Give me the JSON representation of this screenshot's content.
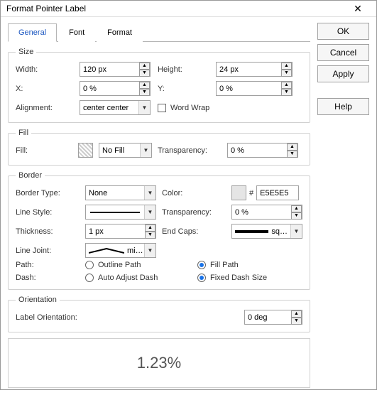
{
  "window": {
    "title": "Format Pointer Label"
  },
  "tabs": [
    "General",
    "Font",
    "Format"
  ],
  "buttons": {
    "ok": "OK",
    "cancel": "Cancel",
    "apply": "Apply",
    "help": "Help"
  },
  "size": {
    "legend": "Size",
    "width_label": "Width:",
    "width_value": "120 px",
    "height_label": "Height:",
    "height_value": "24 px",
    "x_label": "X:",
    "x_value": "0 %",
    "y_label": "Y:",
    "y_value": "0 %",
    "align_label": "Alignment:",
    "align_value": "center center",
    "wrap_label": "Word Wrap"
  },
  "fill": {
    "legend": "Fill",
    "fill_label": "Fill:",
    "fill_value": "No Fill",
    "trans_label": "Transparency:",
    "trans_value": "0 %"
  },
  "border": {
    "legend": "Border",
    "type_label": "Border Type:",
    "type_value": "None",
    "color_label": "Color:",
    "color_hash": "#",
    "color_value": "E5E5E5",
    "style_label": "Line Style:",
    "trans_label": "Transparency:",
    "trans_value": "0 %",
    "thick_label": "Thickness:",
    "thick_value": "1 px",
    "endcaps_label": "End Caps:",
    "endcaps_value": "sq…",
    "joint_label": "Line Joint:",
    "joint_value": "mi…",
    "path_label": "Path:",
    "path_outline": "Outline Path",
    "path_fill": "Fill Path",
    "dash_label": "Dash:",
    "dash_auto": "Auto Adjust Dash",
    "dash_fixed": "Fixed Dash Size"
  },
  "orientation": {
    "legend": "Orientation",
    "label": "Label Orientation:",
    "value": "0 deg"
  },
  "preview": {
    "text": "1.23%"
  }
}
